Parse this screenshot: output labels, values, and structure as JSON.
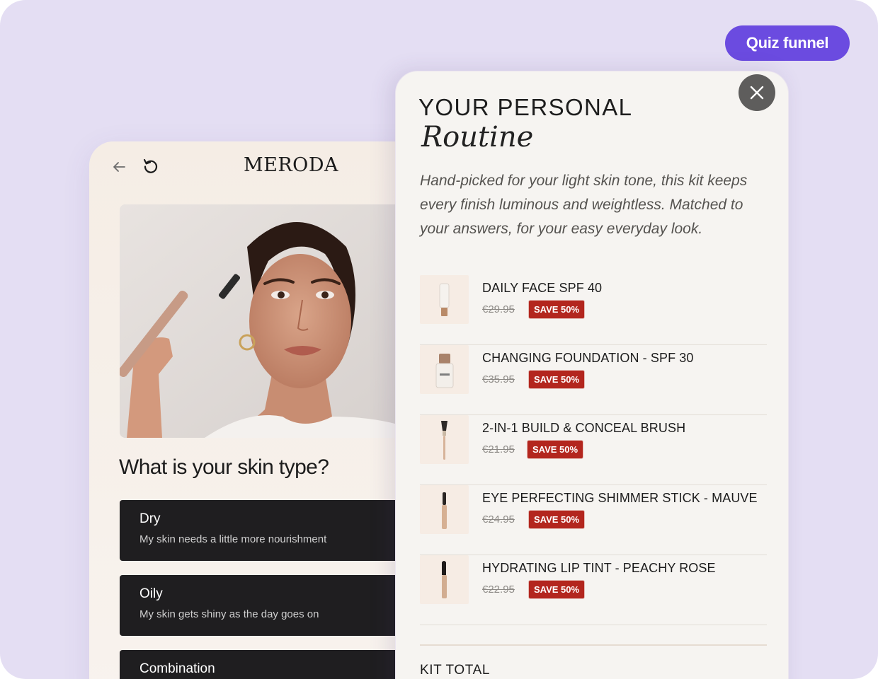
{
  "badge": {
    "label": "Quiz funnel"
  },
  "quiz": {
    "brand": "MERODA",
    "question": "What is your skin type?",
    "options": [
      {
        "title": "Dry",
        "description": "My skin needs a little more nourishment"
      },
      {
        "title": "Oily",
        "description": "My skin gets shiny as the day goes on"
      },
      {
        "title": "Combination",
        "description": ""
      }
    ]
  },
  "result": {
    "kicker": "YOUR PERSONAL",
    "title": "Routine",
    "intro": "Hand-picked for your light skin tone, this kit keeps every finish luminous and weightless. Matched to your answers, for your easy everyday look.",
    "products": [
      {
        "name": "DAILY FACE SPF 40",
        "price": "€29.95",
        "badge": "SAVE 50%"
      },
      {
        "name": "CHANGING FOUNDATION - SPF 30",
        "price": "€35.95",
        "badge": "SAVE 50%"
      },
      {
        "name": "2-IN-1 BUILD & CONCEAL BRUSH",
        "price": "€21.95",
        "badge": "SAVE 50%"
      },
      {
        "name": "EYE PERFECTING SHIMMER STICK - MAUVE",
        "price": "€24.95",
        "badge": "SAVE 50%"
      },
      {
        "name": "HYDRATING LIP TINT - PEACHY ROSE",
        "price": "€22.95",
        "badge": "SAVE 50%"
      }
    ],
    "kit_total_label": "KIT TOTAL"
  },
  "colors": {
    "background": "#e4def3",
    "accent": "#6b4be0",
    "option_dark": "#1f1e20",
    "save_badge": "#b3261e"
  },
  "icons": [
    "back-arrow-icon",
    "reload-icon",
    "close-icon"
  ]
}
